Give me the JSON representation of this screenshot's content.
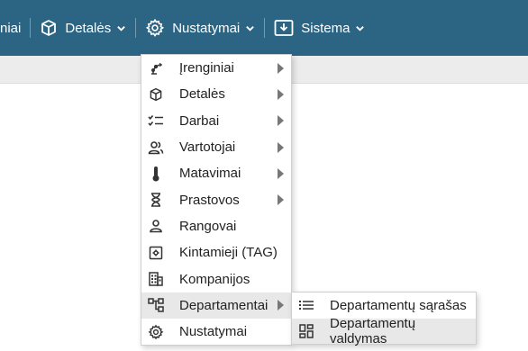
{
  "navbar": {
    "items": [
      {
        "label": "niai"
      },
      {
        "label": "Detalės"
      },
      {
        "label": "Nustatymai"
      },
      {
        "label": "Sistema"
      }
    ]
  },
  "menu": {
    "items": [
      {
        "label": "Įrenginiai",
        "icon": "robot-arm-icon"
      },
      {
        "label": "Detalės",
        "icon": "cube-icon"
      },
      {
        "label": "Darbai",
        "icon": "checklist-icon"
      },
      {
        "label": "Vartotojai",
        "icon": "users-icon"
      },
      {
        "label": "Matavimai",
        "icon": "thermometer-icon"
      },
      {
        "label": "Prastovos",
        "icon": "hourglass-icon"
      },
      {
        "label": "Rangovai",
        "icon": "user-icon"
      },
      {
        "label": "Kintamieji (TAG)",
        "icon": "tag-gear-icon"
      },
      {
        "label": "Kompanijos",
        "icon": "building-icon"
      },
      {
        "label": "Departamentai",
        "icon": "hierarchy-icon"
      },
      {
        "label": "Nustatymai",
        "icon": "gear-icon"
      }
    ]
  },
  "submenu": {
    "items": [
      {
        "label": "Departamentų sąrašas",
        "icon": "list-icon"
      },
      {
        "label": "Departamentų valdymas",
        "icon": "dashboard-icon"
      }
    ]
  },
  "colors": {
    "navbar": "#2c6484",
    "active_item": "#e8e8e8"
  }
}
